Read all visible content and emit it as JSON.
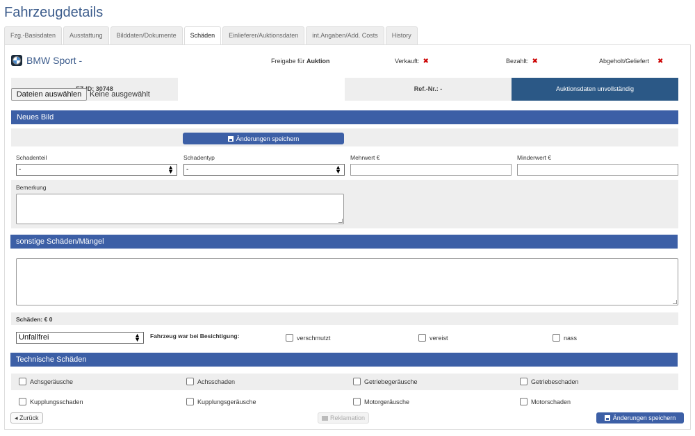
{
  "page_title": "Fahrzeugdetails",
  "tabs": [
    {
      "label": "Fzg.-Basisdaten"
    },
    {
      "label": "Ausstattung"
    },
    {
      "label": "Bilddaten/Dokumente"
    },
    {
      "label": "Schäden",
      "active": true
    },
    {
      "label": "Einlieferer/Auktionsdaten"
    },
    {
      "label": "int.Angaben/Add. Costs"
    },
    {
      "label": "History"
    }
  ],
  "vehicle": {
    "name": "BMW Sport",
    "suffix": " -",
    "release_label": "Freigabe für",
    "release_value": "Auktion",
    "sold_label": "Verkauft:",
    "paid_label": "Bezahlt:",
    "delivered_label": "Abgeholt/Geliefert",
    "x_mark": "✖"
  },
  "info_bar": {
    "fz_id": "FZ-ID: 30748",
    "ref_nr": "Ref.-Nr.: -",
    "auction_status": "Auktionsdaten unvollständig"
  },
  "new_image": {
    "header": "Neues Bild",
    "file_button": "Dateien auswählen",
    "file_status": "Keine ausgewählt",
    "save_button": "Änderungen speichern",
    "damage_part_label": "Schadenteil",
    "damage_part_value": "-",
    "damage_type_label": "Schadentyp",
    "damage_type_value": "-",
    "added_value_label": "Mehrwert €",
    "reduced_value_label": "Minderwert €",
    "remark_label": "Bemerkung"
  },
  "other_damage": {
    "header": "sonstige Schäden/Mängel",
    "total": "Schäden: € 0",
    "condition_value": "Unfallfrei",
    "inspection_label": "Fahrzeug war bei Besichtigung:",
    "options": [
      "verschmutzt",
      "vereist",
      "nass"
    ]
  },
  "technical_damage": {
    "header": "Technische Schäden",
    "row1": [
      "Achsgeräusche",
      "Achsschaden",
      "Getriebegeräusche",
      "Getriebeschaden"
    ],
    "row2": [
      "Kupplungsschaden",
      "Kupplungsgeräusche",
      "Motorgeräusche",
      "Motorschaden"
    ]
  },
  "footer": {
    "back_button": "◂ Zurück",
    "complaint_button": "Reklamation",
    "save_button": "Änderungen speichern"
  }
}
